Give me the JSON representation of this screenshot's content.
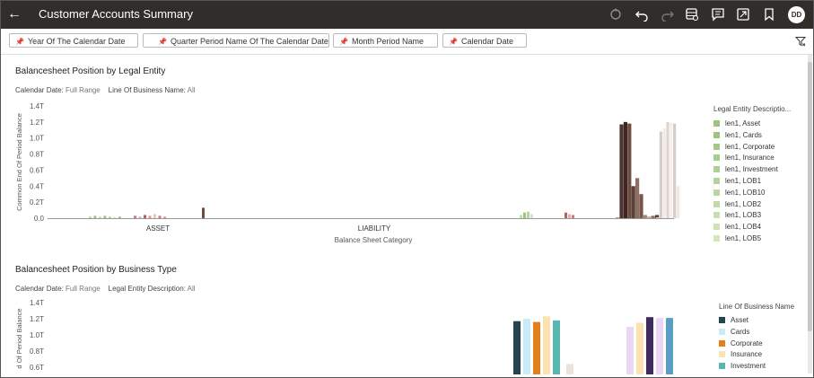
{
  "header": {
    "title": "Customer Accounts Summary",
    "avatar_initials": "DD"
  },
  "filters": [
    {
      "label": "Year Of The Calendar Date"
    },
    {
      "label": "Quarter Period Name Of The Calendar Date"
    },
    {
      "label": "Month Period Name"
    },
    {
      "label": "Calendar Date"
    }
  ],
  "sections": [
    {
      "title": "Balancesheet Position by Legal Entity",
      "filter1_label": "Calendar Date:",
      "filter1_value": "Full Range",
      "filter2_label": "Line Of Business Name:",
      "filter2_value": "All",
      "legend_title": "Legal Entity Descriptio...",
      "legend": [
        "len1, Asset",
        "len1, Cards",
        "len1, Corporate",
        "len1, Insurance",
        "len1, Investment",
        "len1, LOB1",
        "len1, LOB10",
        "len1, LOB2",
        "len1, LOB3",
        "len1, LOB4",
        "len1, LOB5"
      ]
    },
    {
      "title": "Balancesheet Position by Business Type",
      "filter1_label": "Calendar Date:",
      "filter1_value": "Full Range",
      "filter2_label": "Legal Entity Description:",
      "filter2_value": "All",
      "legend_title": "Line Of Business Name",
      "legend": [
        "Asset",
        "Cards",
        "Corporate",
        "Insurance",
        "Investment"
      ]
    }
  ],
  "colors": {
    "topbar": "#312d2a",
    "legend_le": [
      "#9dc47e",
      "#9dc47e",
      "#a3c985",
      "#a9cd8b",
      "#aed091",
      "#b4d498",
      "#bad79f",
      "#c0dba6",
      "#c6dfad",
      "#cde2b5",
      "#d3e6bd"
    ],
    "legend_bt": [
      "#24454f",
      "#c8ecf7",
      "#e37e1c",
      "#fbe2b0",
      "#5ab6b1"
    ]
  },
  "chart_data": [
    {
      "type": "bar",
      "title": "Balancesheet Position by Legal Entity",
      "xlabel": "Balance Sheet Category",
      "ylabel": "Common End Of Period Balance",
      "categories": [
        "ASSET",
        "LIABILITY",
        ""
      ],
      "yticks": [
        "0.0",
        "0.2T",
        "0.4T",
        "0.6T",
        "0.8T",
        "1.0T",
        "1.2T",
        "1.4T"
      ],
      "ylim": [
        0,
        1.4
      ],
      "groups": [
        {
          "values": [
            0.02,
            0.03,
            0.02,
            0.03,
            0.02,
            0.015,
            0.02
          ],
          "colors": [
            "#b5d69a",
            "#9dc47e",
            "#c6dfad",
            "#9dc47e",
            "#b5d69a",
            "#d3e6bd",
            "#9dc47e"
          ]
        },
        {
          "values": [
            0.03,
            0.02,
            0.04,
            0.03,
            0.05,
            0.03,
            0.02
          ],
          "colors": [
            "#c87a7a",
            "#e0b0b0",
            "#b86060",
            "#d99a9a",
            "#e8c4c4",
            "#c87a7a",
            "#d99a9a"
          ]
        },
        {
          "values": [
            0.13
          ],
          "colors": [
            "#6d4c41"
          ]
        },
        {
          "values": [
            0.04,
            0.07,
            0.08,
            0.05
          ],
          "colors": [
            "#c6dfad",
            "#9dc47e",
            "#b5d69a",
            "#d3e6bd"
          ]
        },
        {
          "values": [
            0.07,
            0.05,
            0.04
          ],
          "colors": [
            "#b86060",
            "#e0b0b0",
            "#c87a7a"
          ]
        },
        {
          "values": [
            0.01,
            1.17,
            1.2,
            1.18,
            0.4,
            0.5,
            0.3,
            0.04,
            0.02,
            0.03,
            0.04
          ],
          "colors": [
            "#9a9a9a",
            "#4e342e",
            "#3e2723",
            "#6d4c41",
            "#5d4037",
            "#8d6e63",
            "#795548",
            "#a1887f",
            "#bcaaa4",
            "#8d6e63",
            "#5d4037"
          ]
        },
        {
          "values": [
            0.01,
            1.08,
            1.12,
            1.2,
            1.19,
            1.18,
            0.4
          ],
          "colors": [
            "#e8ddd6",
            "#d7ccc8",
            "#efebe9",
            "#e0d4cf",
            "#f5f0ee",
            "#d7ccc8",
            "#efe8e4"
          ]
        }
      ]
    },
    {
      "type": "bar",
      "title": "Balancesheet Position by Business Type",
      "ylabel": "d Of Period Balance",
      "series_names": [
        "Asset",
        "Cards",
        "Corporate",
        "Insurance",
        "Investment"
      ],
      "yticks": [
        "0.6T",
        "0.8T",
        "1.0T",
        "1.2T",
        "1.4T"
      ],
      "ylim": [
        0.6,
        1.4
      ],
      "groups": [
        {
          "values": [
            1.17,
            1.2,
            1.16,
            1.23,
            1.18
          ],
          "colors": [
            "#24454f",
            "#c8ecf7",
            "#e37e1c",
            "#fbe2b0",
            "#5ab6b1"
          ]
        },
        {
          "values": [
            0.64
          ],
          "colors": [
            "#ede3dc"
          ]
        },
        {
          "values": [
            1.1,
            1.15,
            1.22,
            1.21,
            1.21
          ],
          "colors": [
            "#e9d7f5",
            "#fbe2b0",
            "#3e2a5c",
            "#e9d7f5",
            "#5a9ec4"
          ]
        }
      ]
    }
  ]
}
